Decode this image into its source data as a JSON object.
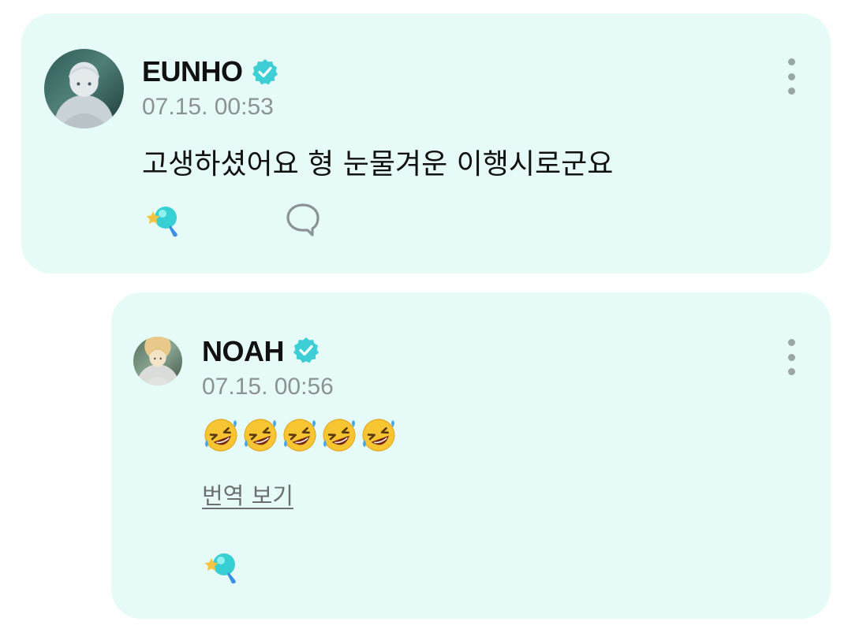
{
  "colors": {
    "card_bg": "#e6fbf7",
    "verified": "#3ecfd6",
    "muted_text": "#8a9294"
  },
  "post": {
    "author": "EUNHO",
    "timestamp": "07.15. 00:53",
    "text": "고생하셨어요 형 눈물겨운 이행시로군요",
    "icons": [
      "avatar",
      "verified-badge-icon",
      "more-options-icon",
      "cheer-icon",
      "comment-icon"
    ]
  },
  "reply": {
    "author": "NOAH",
    "timestamp": "07.15. 00:56",
    "emoji_count": 5,
    "emoji_name": "rolling-on-the-floor-laughing",
    "translate_label": "번역 보기",
    "icons": [
      "avatar",
      "verified-badge-icon",
      "more-options-icon",
      "cheer-icon"
    ]
  }
}
